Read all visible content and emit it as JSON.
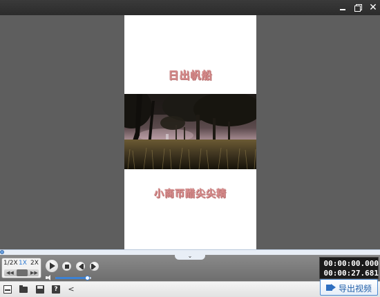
{
  "window": {
    "minimize_icon": "minimize-icon",
    "maximize_icon": "restore-icon",
    "close_glyph": "✕"
  },
  "preview": {
    "title": "日出帆船",
    "caption": "小商帀醋尖尖精"
  },
  "playback": {
    "speeds": [
      "1/2X",
      "1X",
      "2X"
    ],
    "selected_speed": "1X",
    "current_time": "00:00:00.000",
    "total_time": "00:00:27.681",
    "progress": 0.0,
    "volume": 0.9,
    "collapse_glyph": "⌄"
  },
  "toolbar": {
    "share_glyph": "<",
    "help_glyph": "?",
    "export_label": "导出视频"
  }
}
